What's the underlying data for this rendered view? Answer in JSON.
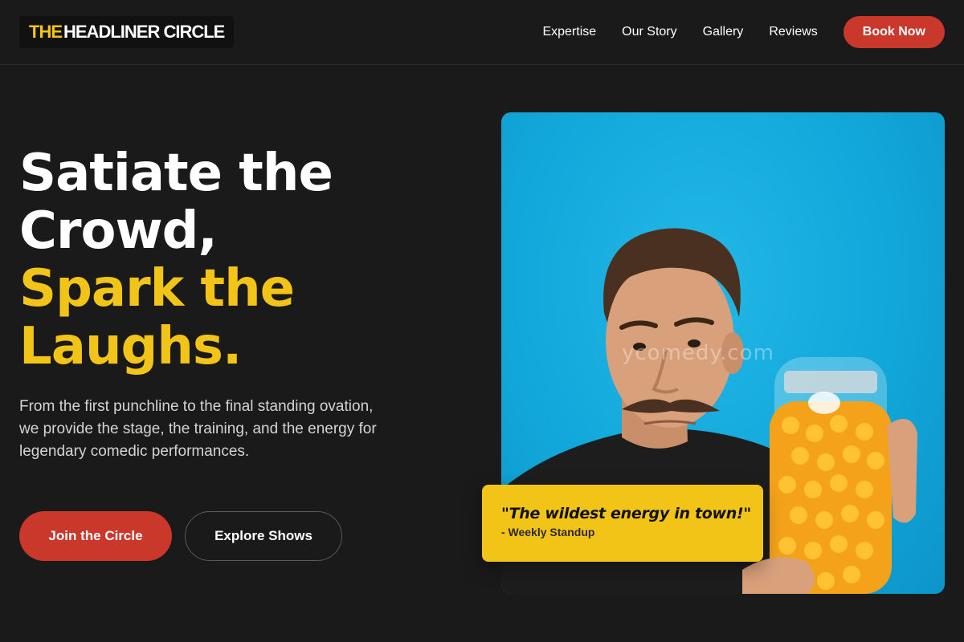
{
  "header": {
    "logo": {
      "accent": "THE",
      "rest": "HEADLINER CIRCLE"
    },
    "nav": [
      {
        "label": "Expertise"
      },
      {
        "label": "Our Story"
      },
      {
        "label": "Gallery"
      },
      {
        "label": "Reviews"
      }
    ],
    "cta_label": "Book Now"
  },
  "hero": {
    "title_lines": [
      "Satiate the",
      "Crowd,"
    ],
    "title_highlight_lines": [
      "Spark the",
      "Laughs."
    ],
    "description": "From the first punchline to the final standing ovation, we provide the stage, the training, and the energy for legendary comedic performances.",
    "primary_cta": "Join the Circle",
    "secondary_cta": "Explore Shows",
    "image": {
      "watermark": "ycomedy.com",
      "quote": "\"The wildest energy in town!\"",
      "quote_attribution": "- Weekly Standup"
    }
  },
  "colors": {
    "background": "#1a1a1a",
    "accent_yellow": "#f2c418",
    "accent_red": "#c9382b",
    "image_background": "#12a7da"
  },
  "icons": []
}
